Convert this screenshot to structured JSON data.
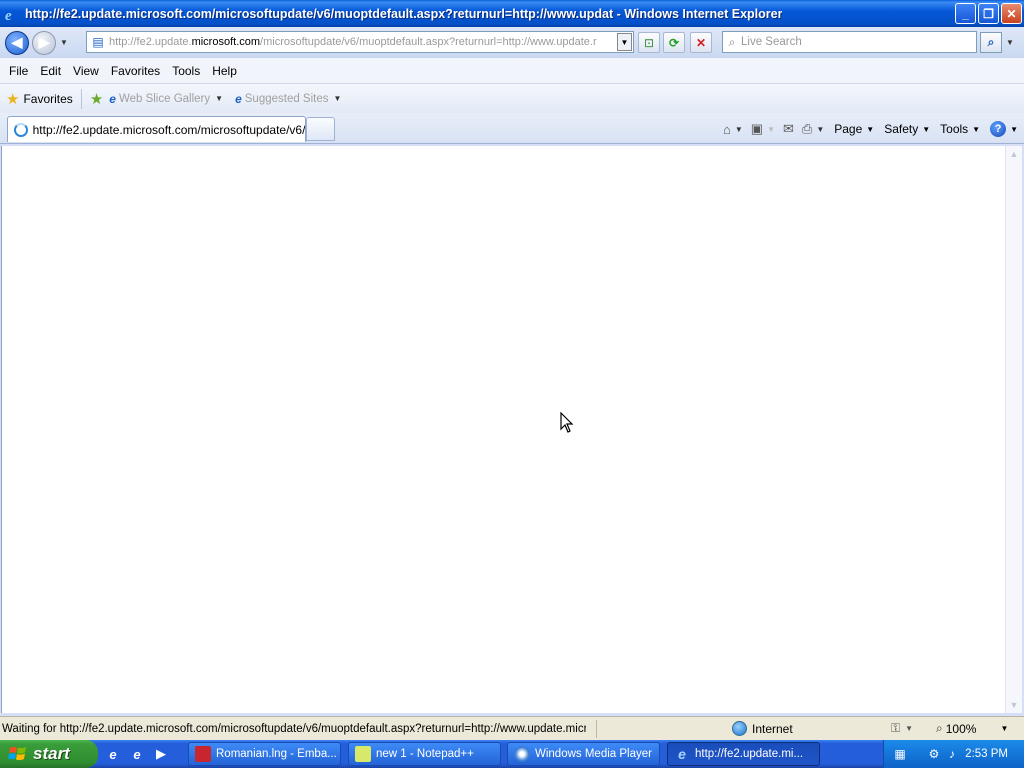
{
  "window": {
    "title": "http://fe2.update.microsoft.com/microsoftupdate/v6/muoptdefault.aspx?returnurl=http://www.updat - Windows Internet Explorer",
    "minimize": "_",
    "maximize": "❐",
    "close": "✕"
  },
  "address": {
    "prefix": "http://fe2.update.",
    "domain": "microsoft.com",
    "suffix": "/microsoftupdate/v6/muoptdefault.aspx?returnurl=http://www.update.r",
    "search_placeholder": "Live Search"
  },
  "menu": [
    "File",
    "Edit",
    "View",
    "Favorites",
    "Tools",
    "Help"
  ],
  "favorites_bar": {
    "favorites_label": "Favorites",
    "links": [
      "Web Slice Gallery",
      "Suggested Sites"
    ]
  },
  "tab": {
    "label": "http://fe2.update.microsoft.com/microsoftupdate/v6/..."
  },
  "command_bar": {
    "page": "Page",
    "safety": "Safety",
    "tools": "Tools"
  },
  "status": {
    "text": "Waiting for http://fe2.update.microsoft.com/microsoftupdate/v6/muoptdefault.aspx?returnurl=http://www.update.micro",
    "zone": "Internet",
    "zoom": "100%"
  },
  "taskbar": {
    "start_label": "start",
    "tasks": [
      "Romanian.lng - Emba...",
      "new 1 - Notepad++",
      "Windows Media Player",
      "http://fe2.update.mi..."
    ],
    "clock": "2:53 PM"
  },
  "colors": {
    "titlebar": "#0658d8",
    "taskbar": "#245edb",
    "start_button": "#3a9c3a",
    "content_bg": "#ffffff"
  }
}
